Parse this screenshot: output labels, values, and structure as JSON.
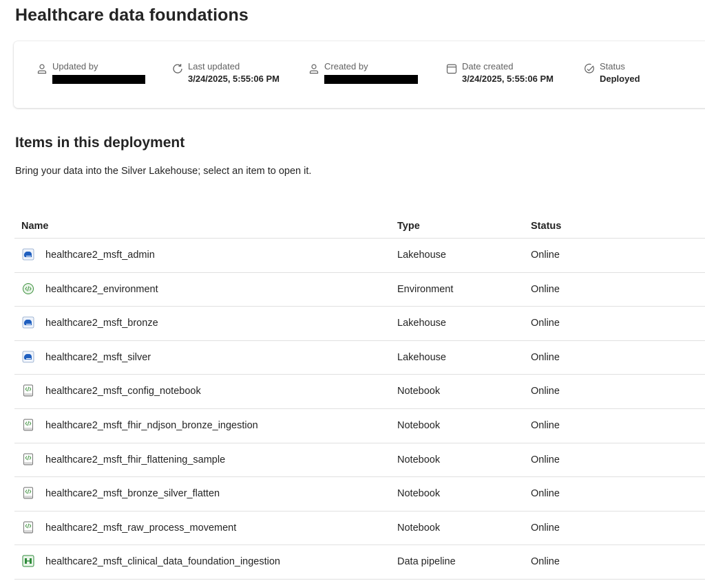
{
  "page": {
    "title": "Healthcare data foundations"
  },
  "metadata": {
    "updated_by": {
      "label": "Updated by",
      "value": ""
    },
    "last_updated": {
      "label": "Last updated",
      "value": "3/24/2025, 5:55:06 PM"
    },
    "created_by": {
      "label": "Created by",
      "value": ""
    },
    "date_created": {
      "label": "Date created",
      "value": "3/24/2025, 5:55:06 PM"
    },
    "status": {
      "label": "Status",
      "value": "Deployed"
    }
  },
  "items_section": {
    "title": "Items in this deployment",
    "description": "Bring your data into the Silver Lakehouse; select an item to open it."
  },
  "table": {
    "columns": {
      "name": "Name",
      "type": "Type",
      "status": "Status"
    },
    "rows": [
      {
        "name": "healthcare2_msft_admin",
        "type": "Lakehouse",
        "status": "Online",
        "icon": "lakehouse-icon"
      },
      {
        "name": "healthcare2_environment",
        "type": "Environment",
        "status": "Online",
        "icon": "environment-icon"
      },
      {
        "name": "healthcare2_msft_bronze",
        "type": "Lakehouse",
        "status": "Online",
        "icon": "lakehouse-icon"
      },
      {
        "name": "healthcare2_msft_silver",
        "type": "Lakehouse",
        "status": "Online",
        "icon": "lakehouse-icon"
      },
      {
        "name": "healthcare2_msft_config_notebook",
        "type": "Notebook",
        "status": "Online",
        "icon": "notebook-icon"
      },
      {
        "name": "healthcare2_msft_fhir_ndjson_bronze_ingestion",
        "type": "Notebook",
        "status": "Online",
        "icon": "notebook-icon"
      },
      {
        "name": "healthcare2_msft_fhir_flattening_sample",
        "type": "Notebook",
        "status": "Online",
        "icon": "notebook-icon"
      },
      {
        "name": "healthcare2_msft_bronze_silver_flatten",
        "type": "Notebook",
        "status": "Online",
        "icon": "notebook-icon"
      },
      {
        "name": "healthcare2_msft_raw_process_movement",
        "type": "Notebook",
        "status": "Online",
        "icon": "notebook-icon"
      },
      {
        "name": "healthcare2_msft_clinical_data_foundation_ingestion",
        "type": "Data pipeline",
        "status": "Online",
        "icon": "pipeline-icon"
      }
    ]
  },
  "colors": {
    "lakehouse": "#1f5fbf",
    "environment": "#3a8f3a",
    "notebook": "#3a8f3a",
    "pipeline": "#2e8b3a",
    "text": "#242424",
    "muted": "#616161",
    "border": "#e0e0e0"
  }
}
